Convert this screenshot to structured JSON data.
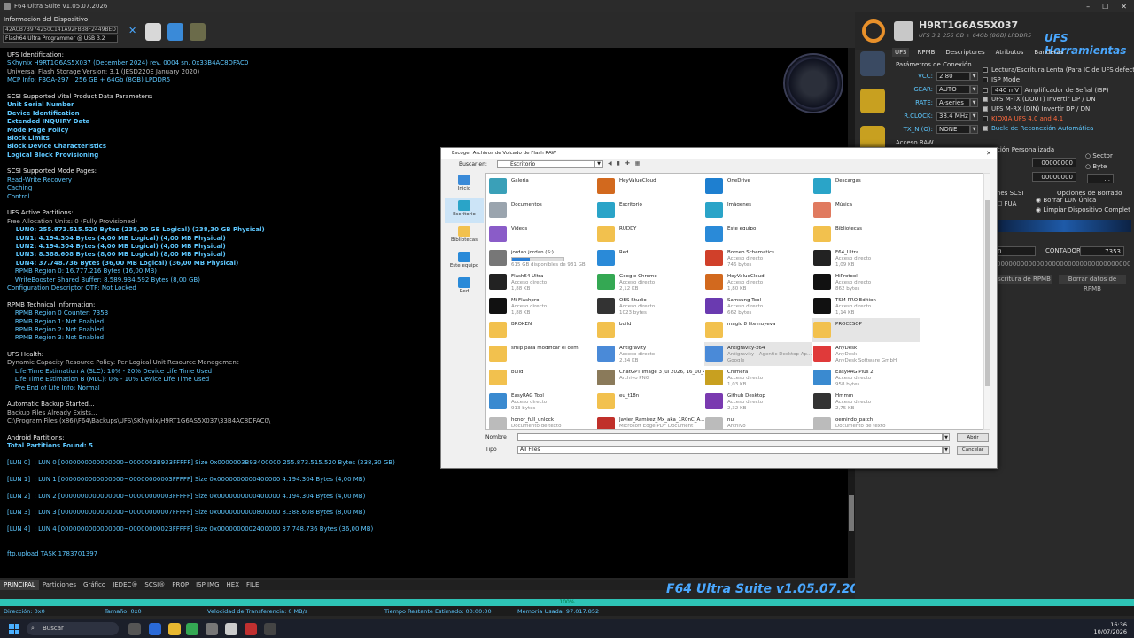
{
  "window": {
    "title": "F64 Ultra Suite v1.05.07.2026",
    "min": "–",
    "max": "☐",
    "close": "✕"
  },
  "device": {
    "label": "Información del Dispositivo",
    "serial": "42ACB7B974250C141A92FBB8F2449BED",
    "programmer": "Flash64 Ultra Programmer @ USB 3.2"
  },
  "console": [
    {
      "t": "UFS Identification:",
      "c": "white"
    },
    {
      "t": "SKhynix H9RT1G6AS5X037 (December 2024) rev. 0004 sn. 0x33B4AC8DFAC0",
      "c": "cyan"
    },
    {
      "t": "Universal Flash Storage Version: 3.1 (JESD220E January 2020)",
      "c": "gray"
    },
    {
      "t": "MCP Info: FBGA-297   256 GB + 64Gb (8GB) LPDDR5",
      "c": "cyan"
    },
    {
      "t": "",
      "c": "white"
    },
    {
      "t": "SCSI Supported Vital Product Data Parameters:",
      "c": "white"
    },
    {
      "t": "Unit Serial Number",
      "c": "cyan bold"
    },
    {
      "t": "Device Identification",
      "c": "cyan bold"
    },
    {
      "t": "Extended INQUIRY Data",
      "c": "cyan bold"
    },
    {
      "t": "Mode Page Policy",
      "c": "cyan bold"
    },
    {
      "t": "Block Limits",
      "c": "cyan bold"
    },
    {
      "t": "Block Device Characteristics",
      "c": "cyan bold"
    },
    {
      "t": "Logical Block Provisioning",
      "c": "cyan bold"
    },
    {
      "t": "",
      "c": "white"
    },
    {
      "t": "SCSI Supported Mode Pages:",
      "c": "white"
    },
    {
      "t": "Read-Write Recovery",
      "c": "cyan"
    },
    {
      "t": "Caching",
      "c": "cyan"
    },
    {
      "t": "Control",
      "c": "cyan"
    },
    {
      "t": "",
      "c": "white"
    },
    {
      "t": "UFS Active Partitions:",
      "c": "white"
    },
    {
      "t": "Free Allocation Units: 0 (Fully Provisioned)",
      "c": "gray"
    },
    {
      "t": "    LUN0: 255.873.515.520 Bytes (238,30 GB Logical) (238,30 GB Physical)",
      "c": "cyan bold"
    },
    {
      "t": "    LUN1: 4.194.304 Bytes (4,00 MB Logical) (4,00 MB Physical)",
      "c": "cyan bold"
    },
    {
      "t": "    LUN2: 4.194.304 Bytes (4,00 MB Logical) (4,00 MB Physical)",
      "c": "cyan bold"
    },
    {
      "t": "    LUN3: 8.388.608 Bytes (8,00 MB Logical) (8,00 MB Physical)",
      "c": "cyan bold"
    },
    {
      "t": "    LUN4: 37.748.736 Bytes (36,00 MB Logical) (36,00 MB Physical)",
      "c": "cyan bold"
    },
    {
      "t": "    RPMB Region 0: 16.777.216 Bytes (16,00 MB)",
      "c": "cyan"
    },
    {
      "t": "    WriteBooster Shared Buffer: 8.589.934.592 Bytes (8,00 GB)",
      "c": "cyan"
    },
    {
      "t": "Configuration Descriptor OTP: Not Locked",
      "c": "cyan"
    },
    {
      "t": "",
      "c": "white"
    },
    {
      "t": "RPMB Technical Information:",
      "c": "white"
    },
    {
      "t": "    RPMB Region 0 Counter: 7353",
      "c": "cyan"
    },
    {
      "t": "    RPMB Region 1: Not Enabled",
      "c": "cyan"
    },
    {
      "t": "    RPMB Region 2: Not Enabled",
      "c": "cyan"
    },
    {
      "t": "    RPMB Region 3: Not Enabled",
      "c": "cyan"
    },
    {
      "t": "",
      "c": "white"
    },
    {
      "t": "UFS Health:",
      "c": "white"
    },
    {
      "t": "Dynamic Capacity Resource Policy: Per Logical Unit Resource Management",
      "c": "gray"
    },
    {
      "t": "    Life Time Estimation A (SLC): 10% - 20% Device Life Time Used",
      "c": "cyan"
    },
    {
      "t": "    Life Time Estimation B (MLC): 0% - 10% Device Life Time Used",
      "c": "cyan"
    },
    {
      "t": "    Pre End of Life Info: Normal",
      "c": "cyan"
    },
    {
      "t": "",
      "c": "white"
    },
    {
      "t": "Automatic Backup Started...",
      "c": "white"
    },
    {
      "t": "Backup Files Already Exists...",
      "c": "gray"
    },
    {
      "t": "C:\\Program Files (x86)\\F64\\Backups\\UFS\\SKhynix\\H9RT1G6AS5X037\\33B4AC8DFAC0\\",
      "c": "gray"
    },
    {
      "t": "",
      "c": "white"
    },
    {
      "t": "Android Partitions:",
      "c": "white"
    },
    {
      "t": "Total Partitions Found: 5",
      "c": "cyan bold"
    },
    {
      "t": "",
      "c": "white"
    },
    {
      "t": "[LUN 0]  : LUN 0 [0000000000000000~0000003B933FFFFF] Size 0x0000003B93400000 255.873.515.520 Bytes (238,30 GB)",
      "c": "cyan"
    },
    {
      "t": "",
      "c": "white"
    },
    {
      "t": "[LUN 1]  : LUN 1 [0000000000000000~00000000003FFFFF] Size 0x0000000000400000 4.194.304 Bytes (4,00 MB)",
      "c": "cyan"
    },
    {
      "t": "",
      "c": "white"
    },
    {
      "t": "[LUN 2]  : LUN 2 [0000000000000000~00000000003FFFFF] Size 0x0000000000400000 4.194.304 Bytes (4,00 MB)",
      "c": "cyan"
    },
    {
      "t": "",
      "c": "white"
    },
    {
      "t": "[LUN 3]  : LUN 3 [0000000000000000~00000000007FFFFF] Size 0x0000000000800000 8.388.608 Bytes (8,00 MB)",
      "c": "cyan"
    },
    {
      "t": "",
      "c": "white"
    },
    {
      "t": "[LUN 4]  : LUN 4 [0000000000000000~00000000023FFFFF] Size 0x0000000002400000 37.748.736 Bytes (36,00 MB)",
      "c": "cyan"
    },
    {
      "t": "",
      "c": "white"
    },
    {
      "t": "",
      "c": "white"
    },
    {
      "t": "ftp.upload TASK 1783701397",
      "c": "cyan"
    }
  ],
  "bottom_tabs": [
    "PRINCIPAL",
    "Particiones",
    "Gráfico",
    "JEDEC®",
    "SCSI®",
    "PROP",
    "ISP IMG",
    "HEX",
    "FILE"
  ],
  "brand": "F64 Ultra Suite v1.05.07.2026",
  "progress": {
    "label": "100%",
    "value": 1.0
  },
  "status": {
    "direccion": "Dirección: 0x0",
    "tamano": "Tamaño: 0x0",
    "velocidad": "Velocidad de Transferencia: 0 MB/s",
    "tiempo": "Tiempo Restante Estimado: 00:00:00",
    "memoria": "Memoria Usada: 97.017.852"
  },
  "taskbar": {
    "search": "Buscar",
    "time": "16:36",
    "date": "10/07/2026"
  },
  "right": {
    "model": "H9RT1G6AS5X037",
    "spec": "UFS 3.1   256 GB + 64Gb (8GB) LPDDR5",
    "tools": "UFS Herramientas",
    "tabs": [
      "UFS",
      "RPMB",
      "Descriptores",
      "Atributos",
      "Banderas"
    ],
    "conn_title": "Parámetros de Conexión",
    "vcc": {
      "k": "VCC:",
      "v": "2,80"
    },
    "gear": {
      "k": "GEAR:",
      "v": "AUTO"
    },
    "rate": {
      "k": "RATE:",
      "v": "A-series"
    },
    "rclock": {
      "k": "R.CLOCK:",
      "v": "38.4 MHz"
    },
    "txn": {
      "k": "TX_N (O):",
      "v": "NONE"
    },
    "checks": [
      "Lectura/Escritura Lenta (Para IC de UFS defectuoso)",
      "ISP Mode",
      "440 mV",
      "Amplificador de Señal (ISP)",
      "UFS M-TX (DOUT) Invertir DP / DN",
      "UFS M-RX (DIN) Invertir DP / DN",
      "KIOXIA UFS 4.0 and 4.1",
      "Bucle de Reconexión Automática"
    ],
    "raw": "Acceso RAW",
    "custom": "ción Personalizada",
    "sector": "Sector",
    "byte": "Byte",
    "box1": "00000000",
    "box2": "00000000",
    "scsi_opts": "nes SCSI",
    "erase_opts": "Opciones de Borrado",
    "fua": "FUA",
    "erase_lun": "Borrar LUN Única",
    "wipe": "Limpiar Dispositivo Complet",
    "counter_label": "CONTADOR:",
    "counter_value": "7353",
    "long_box": "0000000000000000000000000000000000000",
    "btn_write": "scritura de RPMB",
    "btn_erase": "Borrar datos de RPMB"
  },
  "dialog": {
    "title": "Escoger Archivos de Volcado de Flash RAW",
    "lookin_label": "Buscar en:",
    "lookin_value": "Escritorio",
    "places": [
      "Inicio",
      "Escritorio",
      "Bibliotecas",
      "Este equipo",
      "Red"
    ],
    "items": [
      {
        "n": "Galería",
        "s1": "",
        "s2": "",
        "col": "#3aa0b8"
      },
      {
        "n": "HeyValueCloud",
        "s1": "",
        "s2": "",
        "col": "#d2691e"
      },
      {
        "n": "OneDrive",
        "s1": "",
        "s2": "",
        "col": "#1e7fd0"
      },
      {
        "n": "Descargas",
        "s1": "",
        "s2": "",
        "col": "#2aa4c8"
      },
      {
        "n": "Documentos",
        "s1": "",
        "s2": "",
        "col": "#9aa4ae"
      },
      {
        "n": "Escritorio",
        "s1": "",
        "s2": "",
        "col": "#2aa4c8"
      },
      {
        "n": "Imágenes",
        "s1": "",
        "s2": "",
        "col": "#2aa4c8"
      },
      {
        "n": "Música",
        "s1": "",
        "s2": "",
        "col": "#e07a5f"
      },
      {
        "n": "Videos",
        "s1": "",
        "s2": "",
        "col": "#8a5cc8"
      },
      {
        "n": "RUDDY",
        "s1": "",
        "s2": "",
        "col": "#f2c14e"
      },
      {
        "n": "Este equipo",
        "s1": "",
        "s2": "",
        "col": "#2a8ad8"
      },
      {
        "n": "Bibliotecas",
        "s1": "",
        "s2": "",
        "col": "#f2c14e"
      },
      {
        "n": "jordan jordan (S:)",
        "s1": "",
        "s2": "615 GB disponibles de 931 GB",
        "col": "#777",
        "bar": 0.35
      },
      {
        "n": "Red",
        "s1": "",
        "s2": "",
        "col": "#2a8ad8"
      },
      {
        "n": "Borneo Schematics",
        "s1": "Acceso directo",
        "s2": "746 bytes",
        "col": "#d0402a"
      },
      {
        "n": "F64_Ultra",
        "s1": "Acceso directo",
        "s2": "1,09 KB",
        "col": "#222"
      },
      {
        "n": "Flash64 Ultra",
        "s1": "Acceso directo",
        "s2": "1,88 KB",
        "col": "#222"
      },
      {
        "n": "Google Chrome",
        "s1": "Acceso directo",
        "s2": "2,12 KB",
        "col": "#34a853"
      },
      {
        "n": "HeyValueCloud",
        "s1": "Acceso directo",
        "s2": "1,80 KB",
        "col": "#d2691e"
      },
      {
        "n": "HiProtool",
        "s1": "Acceso directo",
        "s2": "862 bytes",
        "col": "#111"
      },
      {
        "n": "Mi Flashpro",
        "s1": "Acceso directo",
        "s2": "1,88 KB",
        "col": "#111"
      },
      {
        "n": "OBS Studio",
        "s1": "Acceso directo",
        "s2": "1023 bytes",
        "col": "#333"
      },
      {
        "n": "Samsung Tool",
        "s1": "Acceso directo",
        "s2": "662 bytes",
        "col": "#6a3ab0"
      },
      {
        "n": "TSM-PRO Edition",
        "s1": "Acceso directo",
        "s2": "1,14 KB",
        "col": "#111"
      },
      {
        "n": "BROKEN",
        "s1": "",
        "s2": "",
        "col": "#f2c14e"
      },
      {
        "n": "build",
        "s1": "",
        "s2": "",
        "col": "#f2c14e"
      },
      {
        "n": "magic 8 lite nuyeva",
        "s1": "",
        "s2": "",
        "col": "#f2c14e"
      },
      {
        "n": "PROCESOP",
        "s1": "",
        "s2": "",
        "col": "#f2c14e",
        "hl": true
      },
      {
        "n": "smip para modificar el oem",
        "s1": "",
        "s2": "",
        "col": "#f2c14e"
      },
      {
        "n": "Antigravity",
        "s1": "Acceso directo",
        "s2": "2,34 KB",
        "col": "#4a8ad8"
      },
      {
        "n": "Antigravity-x64",
        "s1": "Antigravity - Agentic Desktop Ap...",
        "s2": "Google",
        "col": "#4a8ad8",
        "hl": true
      },
      {
        "n": "AnyDesk",
        "s1": "AnyDesk",
        "s2": "AnyDesk Software GmbH",
        "col": "#e03a3a"
      },
      {
        "n": "build",
        "s1": "",
        "s2": "",
        "col": "#f2c14e"
      },
      {
        "n": "ChatGPT Image 3 jul 2026, 16_00_40",
        "s1": "Archivo PNG",
        "s2": "",
        "col": "#8a7a5a"
      },
      {
        "n": "Chimera",
        "s1": "Acceso directo",
        "s2": "1,03 KB",
        "col": "#c8a020"
      },
      {
        "n": "EasyRAG Plus 2",
        "s1": "Acceso directo",
        "s2": "958 bytes",
        "col": "#3a8ad0"
      },
      {
        "n": "EasyRAG Tool",
        "s1": "Acceso directo",
        "s2": "913 bytes",
        "col": "#3a8ad0"
      },
      {
        "n": "eu_t18n",
        "s1": "",
        "s2": "",
        "col": "#f2c14e"
      },
      {
        "n": "Github Desktop",
        "s1": "Acceso directo",
        "s2": "2,32 KB",
        "col": "#7a3ab0"
      },
      {
        "n": "Hmmm",
        "s1": "Acceso directo",
        "s2": "2,75 KB",
        "col": "#333"
      },
      {
        "n": "honor_full_unlock",
        "s1": "Documento de texto",
        "s2": "",
        "col": "#bbb"
      },
      {
        "n": "Javier_Ramirez_Mx_aka_1R0nC_A...",
        "s1": "Microsoft Edge PDF Document",
        "s2": "",
        "col": "#c0302a"
      },
      {
        "n": "nul",
        "s1": "Archivo",
        "s2": "",
        "col": "#bbb"
      },
      {
        "n": "oemindo_patch",
        "s1": "Documento de texto",
        "s2": "",
        "col": "#bbb"
      }
    ],
    "name_label": "Nombre",
    "type_label": "Tipo",
    "type_value": "All Files",
    "open": "Abrir",
    "cancel": "Cancelar"
  }
}
